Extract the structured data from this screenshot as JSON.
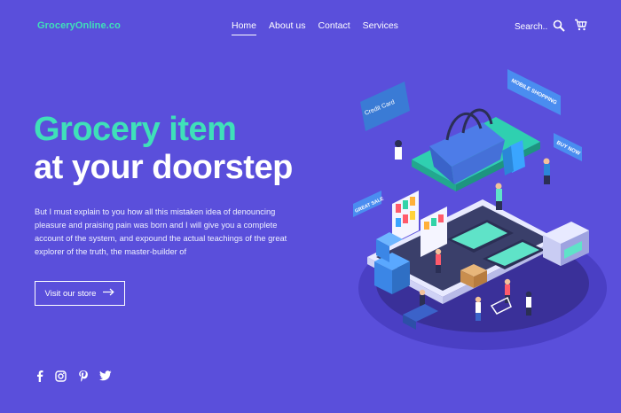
{
  "brand": "GroceryOnline.co",
  "nav": {
    "home": "Home",
    "about": "About us",
    "contact": "Contact",
    "services": "Services"
  },
  "search": {
    "label": "Search.."
  },
  "hero": {
    "title_line1": "Grocery item",
    "title_line2": "at your doorstep",
    "description": "But I must explain to you how all this mistaken idea of denouncing pleasure and praising pain was born and I will give you a complete account of the system, and expound the actual teachings of the great explorer of the truth, the master-builder of",
    "cta_label": "Visit our store"
  },
  "illustration": {
    "credit_card": "Credit Card",
    "mobile_shopping": "MOBILE SHOPPING",
    "buy_now": "BUY NOW",
    "great_sale": "GREAT SALE"
  },
  "icons": [
    "search-icon",
    "cart-icon",
    "arrow-right-icon",
    "facebook-icon",
    "instagram-icon",
    "pinterest-icon",
    "twitter-icon"
  ],
  "colors": {
    "background": "#5a4fdb",
    "accent": "#3fe0b9",
    "text": "#ffffff"
  }
}
